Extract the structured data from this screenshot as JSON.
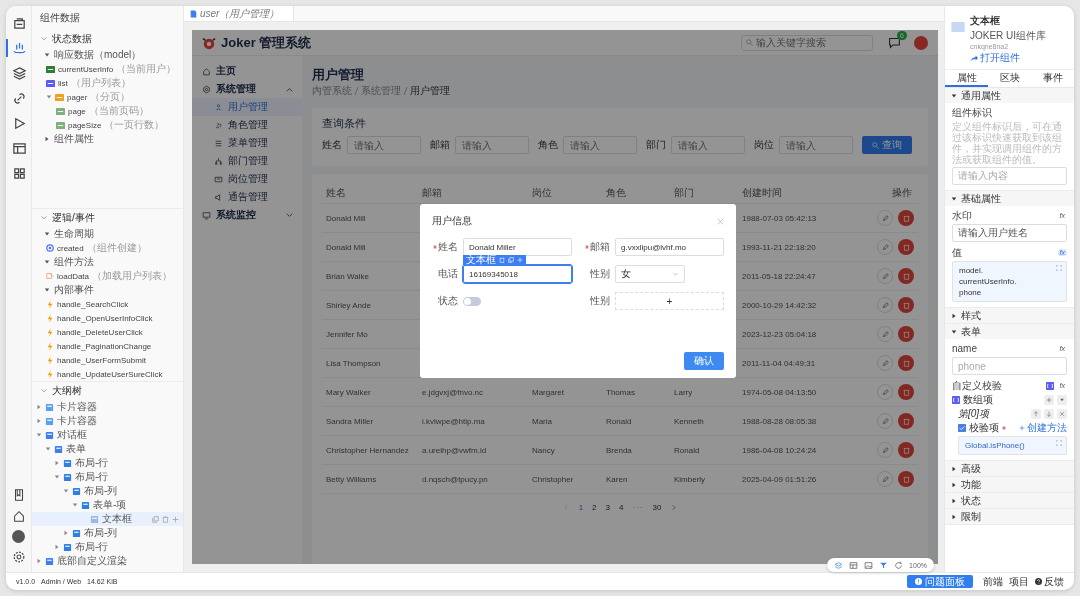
{
  "rail_items": [
    {
      "selected": false
    },
    {
      "selected": true
    },
    {
      "selected": false
    },
    {
      "selected": false
    },
    {
      "selected": false
    },
    {
      "selected": false
    },
    {
      "selected": false
    }
  ],
  "left_panel": {
    "title": "组件数据",
    "sections": [
      {
        "kind": "state",
        "title": "状态数据",
        "expanded": true,
        "groups": [
          {
            "label": "响应数据（model）",
            "expanded": true,
            "items": [
              {
                "kind": "object",
                "name": "currentUserInfo",
                "note": "（当前用户）"
              },
              {
                "kind": "array",
                "name": "list",
                "note": "（用户列表）"
              },
              {
                "kind": "group",
                "name": "pager",
                "note": "（分页）",
                "expanded": true,
                "children": [
                  {
                    "kind": "number",
                    "name": "page",
                    "note": "（当前页码）"
                  },
                  {
                    "kind": "number",
                    "name": "pageSize",
                    "note": "（一页行数）"
                  }
                ]
              }
            ]
          },
          {
            "label": "组件属性",
            "expanded": false
          }
        ]
      },
      {
        "kind": "logic",
        "title": "逻辑/事件",
        "expanded": true,
        "groups": [
          {
            "label": "生命周期",
            "expanded": true,
            "items": [
              {
                "kind": "lifecycle",
                "name": "created",
                "note": "（组件创建）"
              }
            ]
          },
          {
            "label": "组件方法",
            "expanded": true,
            "items": [
              {
                "kind": "method",
                "name": "loadData",
                "note": "（加载用户列表）"
              }
            ]
          },
          {
            "label": "内部事件",
            "expanded": true,
            "items": [
              {
                "kind": "event",
                "name": "handle_SearchClick"
              },
              {
                "kind": "event",
                "name": "handle_OpenUserInfoClick"
              },
              {
                "kind": "event",
                "name": "handle_DeleteUserClick"
              },
              {
                "kind": "event",
                "name": "handle_PaginationChange"
              },
              {
                "kind": "event",
                "name": "handle_UserFormSubmit"
              },
              {
                "kind": "event",
                "name": "handle_UpdateUserSureClick"
              }
            ]
          }
        ]
      },
      {
        "kind": "outline",
        "title": "大纲树",
        "expanded": true,
        "nodes": [
          {
            "kind": "card",
            "label": "卡片容器",
            "expanded": false,
            "selected": false
          },
          {
            "kind": "card",
            "label": "卡片容器",
            "expanded": false,
            "selected": false
          },
          {
            "kind": "dialog",
            "label": "对话框",
            "expanded": true,
            "selected": false,
            "children": [
              {
                "kind": "form",
                "label": "表单",
                "expanded": true,
                "selected": false,
                "children": [
                  {
                    "kind": "row",
                    "label": "布局-行",
                    "expanded": false,
                    "selected": false
                  },
                  {
                    "kind": "row",
                    "label": "布局-行",
                    "expanded": true,
                    "selected": false,
                    "children": [
                      {
                        "kind": "col",
                        "label": "布局-列",
                        "expanded": true,
                        "selected": false,
                        "children": [
                          {
                            "kind": "item",
                            "label": "表单-项",
                            "expanded": true,
                            "selected": false,
                            "children": [
                              {
                                "kind": "input",
                                "label": "文本框",
                                "selected": true
                              }
                            ]
                          }
                        ]
                      },
                      {
                        "kind": "col",
                        "label": "布局-列",
                        "expanded": false,
                        "selected": false
                      }
                    ]
                  },
                  {
                    "kind": "row",
                    "label": "布局-行",
                    "expanded": false,
                    "selected": false
                  }
                ]
              }
            ]
          },
          {
            "kind": "render",
            "label": "底部自定义渲染",
            "expanded": false,
            "selected": false
          }
        ]
      }
    ]
  },
  "tab": {
    "label": "user（用户管理）"
  },
  "preview": {
    "app_title": "Joker 管理系统",
    "search": {
      "placeholder": "输入关键字搜索"
    },
    "message_badge": "6",
    "menu": [
      {
        "label": "主页",
        "selected": false
      },
      {
        "label": "系统管理",
        "selected": false,
        "expanded": true,
        "children": [
          {
            "label": "用户管理",
            "selected": true
          },
          {
            "label": "角色管理",
            "selected": false
          },
          {
            "label": "菜单管理",
            "selected": false
          },
          {
            "label": "部门管理",
            "selected": false
          },
          {
            "label": "岗位管理",
            "selected": false
          },
          {
            "label": "通告管理",
            "selected": false
          }
        ]
      },
      {
        "label": "系统监控",
        "selected": false,
        "expanded": false
      }
    ],
    "page_title": "用户管理",
    "breadcrumb": [
      "内管系统",
      "系统管理",
      "用户管理"
    ],
    "query": {
      "title": "查询条件",
      "fields": [
        {
          "label": "姓名",
          "placeholder": "请输入"
        },
        {
          "label": "邮箱",
          "placeholder": "请输入"
        },
        {
          "label": "角色",
          "placeholder": "请输入"
        },
        {
          "label": "部门",
          "placeholder": "请输入"
        },
        {
          "label": "岗位",
          "placeholder": "请输入"
        }
      ],
      "button": "查询"
    },
    "table": {
      "columns": [
        "姓名",
        "邮箱",
        "岗位",
        "角色",
        "部门",
        "创建时间",
        "操作"
      ],
      "rows": [
        {
          "name": "Donald Mill",
          "created": "1988-07-03 05:42:13"
        },
        {
          "name": "Donald Mill",
          "created": "1993-11-21 22:18:20"
        },
        {
          "name": "Brian Walke",
          "created": "2011-05-18 22:24:47"
        },
        {
          "name": "Shirley Ande",
          "created": "2000-10-29 14:42:32"
        },
        {
          "name": "Jennifer Mo",
          "created": "2023-12-23 05:04:18"
        },
        {
          "name": "Lisa Thompson",
          "created": "2011-11-04 04:49:31"
        },
        {
          "name": "Mary Walker",
          "email": "e.jdgvxj@fnvo.nc",
          "post": "Margaret",
          "role": "Thomas",
          "dept": "Larry",
          "created": "1974-05-08 04:13:50"
        },
        {
          "name": "Sandra Miller",
          "email": "i.kvlwpe@htip.ma",
          "post": "Maria",
          "role": "Ronald",
          "dept": "Kenneth",
          "created": "1988-08-28 08:05:38"
        },
        {
          "name": "Christopher Hernandez",
          "email": "a.ureihp@vwfm.id",
          "post": "Nancy",
          "role": "Brenda",
          "dept": "Ronald",
          "created": "1986-04-08 10:24:24"
        },
        {
          "name": "Betty Williams",
          "email": "d.nqsch@tpucy.pn",
          "post": "Christopher",
          "role": "Karen",
          "dept": "Kimberly",
          "created": "2025-04-09 01:51:26"
        }
      ]
    },
    "pagination": [
      {
        "kind": "page",
        "label": "1",
        "selected": true
      },
      {
        "kind": "page",
        "label": "2",
        "selected": false
      },
      {
        "kind": "page",
        "label": "3",
        "selected": false
      },
      {
        "kind": "page",
        "label": "4",
        "selected": false
      },
      {
        "kind": "ellipsis",
        "label": "···",
        "selected": false
      },
      {
        "kind": "page",
        "label": "30",
        "selected": false
      }
    ],
    "dialog": {
      "title": "用户信息",
      "fields": [
        {
          "kind": "input",
          "label": "姓名",
          "required": true,
          "value": "Donald Miller",
          "selected": false
        },
        {
          "kind": "input",
          "label": "邮箱",
          "required": true,
          "value": "g.vxxlipu@lvhf.mo",
          "selected": false
        },
        {
          "kind": "input",
          "label": "电话",
          "required": false,
          "value": "16169345018",
          "selected": true,
          "tag": "文本框"
        },
        {
          "kind": "select",
          "label": "性别",
          "required": false,
          "value": "女",
          "selected": false
        },
        {
          "kind": "switch",
          "label": "状态",
          "required": false,
          "on": false,
          "selected": false
        },
        {
          "kind": "upload",
          "label": "性别",
          "required": false,
          "value": "+",
          "selected": false
        }
      ],
      "button": "确认"
    }
  },
  "canvas_toolbar": {
    "zoom": "100%"
  },
  "right_panel": {
    "component": {
      "name": "文本框",
      "library": "JOKER UI组件库",
      "id": "cnkqne8na2",
      "open_link": "打开组件"
    },
    "tabs": [
      {
        "label": "属性",
        "selected": true
      },
      {
        "label": "区块",
        "selected": false
      },
      {
        "label": "事件",
        "selected": false
      }
    ],
    "sections": [
      {
        "title": "通用属性",
        "expanded": true,
        "fields": [
          {
            "kind": "textarea",
            "label": "组件标识",
            "description": "定义组件标识后，可在通过该标识快速获取到该组件，并实现调用组件的方法或获取组件的值。",
            "placeholder": "请输入内容"
          }
        ]
      },
      {
        "title": "基础属性",
        "expanded": true,
        "fields": [
          {
            "kind": "textarea",
            "label": "水印",
            "fx": "fx",
            "fx_active": false,
            "value": "请输入用户姓名"
          },
          {
            "kind": "code",
            "label": "值",
            "fx": "fx",
            "fx_active": true,
            "code": "model.\ncurrentUserInfo.\nphone"
          }
        ]
      },
      {
        "title": "样式",
        "expanded": false
      },
      {
        "title": "表单",
        "expanded": true,
        "fields": [
          {
            "kind": "textarea",
            "label": "name",
            "fx": "fx",
            "fx_active": false,
            "placeholder": "phone"
          },
          {
            "kind": "validator",
            "label": "自定义校验",
            "fx": "fx",
            "fx_active": false,
            "array_label": "数组项",
            "item_label": "第[0]项",
            "check_label": "校验项",
            "required": true,
            "create_link": "创建方法",
            "code": "Global.isPhone()"
          }
        ]
      },
      {
        "title": "高级",
        "expanded": false
      },
      {
        "title": "功能",
        "expanded": false
      },
      {
        "title": "状态",
        "expanded": false
      },
      {
        "title": "限制",
        "expanded": false
      }
    ]
  },
  "status_bar": {
    "version": "v1.0.0",
    "user": "Admin / Web",
    "size": "14.62 KiB",
    "problems_button": "问题面板",
    "links": [
      "前端",
      "项目",
      "反馈"
    ]
  }
}
